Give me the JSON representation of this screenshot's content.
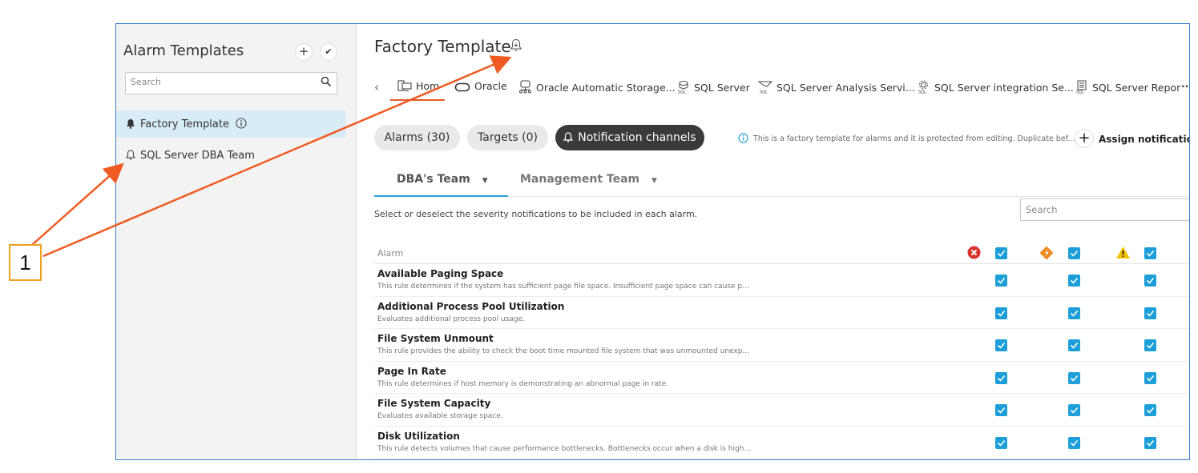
{
  "sidebar": {
    "title": "Alarm Templates",
    "search_placeholder": "Search",
    "items": [
      {
        "label": "Factory Template",
        "active": true
      },
      {
        "label": "SQL Server DBA Team",
        "active": false
      }
    ]
  },
  "main": {
    "title": "Factory Template",
    "tabs": [
      {
        "label": "Hom",
        "icon": "host-icon"
      },
      {
        "label": "Oracle",
        "icon": "oracle-icon"
      },
      {
        "label": "Oracle Automatic Storage...",
        "icon": "database-icon"
      },
      {
        "label": "SQL Server",
        "icon": "sql-server-icon"
      },
      {
        "label": "SQL Server Analysis Servi...",
        "icon": "sql-analysis-icon"
      },
      {
        "label": "SQL Server integration Se...",
        "icon": "sql-integration-icon"
      },
      {
        "label": "SQL Server Repor",
        "icon": "sql-report-icon"
      }
    ],
    "more_tabs": "··",
    "pills": {
      "alarms": "Alarms (30)",
      "targets": "Targets (0)",
      "notification_channels": "Notification channels"
    },
    "info_text": "This is a factory template for alarms and it is protected from editing. Duplicate bef...",
    "assign_label": "Assign notification",
    "team_tabs": [
      "DBA's Team",
      "Management Team"
    ],
    "instructions": "Select or deselect the severity notifications to be included in each alarm.",
    "table_search_placeholder": "Search",
    "table": {
      "column_alarm": "Alarm",
      "rows": [
        {
          "name": "Available Paging Space",
          "desc": "This rule determines if the system has sufficient page file space. Insufficient page space can cause p..."
        },
        {
          "name": "Additional Process Pool Utilization",
          "desc": "Evaluates additional process pool usage."
        },
        {
          "name": "File System Unmount",
          "desc": "This rule provides the ability to check the boot time mounted file system that was unmounted unexp..."
        },
        {
          "name": "Page In Rate",
          "desc": "This rule determines if host memory is demonstrating an abnormal page in rate."
        },
        {
          "name": "File System Capacity",
          "desc": "Evaluates available storage space."
        },
        {
          "name": "Disk Utilization",
          "desc": "This rule detects volumes that cause performance bottlenecks. Bottlenecks occur when a disk is high..."
        }
      ]
    }
  },
  "callout": {
    "label": "1"
  },
  "colors": {
    "accent_blue": "#1c9fd8",
    "frame_border": "#3b79c8",
    "annotation_arrow": "#f05a22",
    "callout_border": "#f0a020",
    "fatal": "#d9342b",
    "critical": "#f08a24",
    "warning": "#f2c200"
  }
}
